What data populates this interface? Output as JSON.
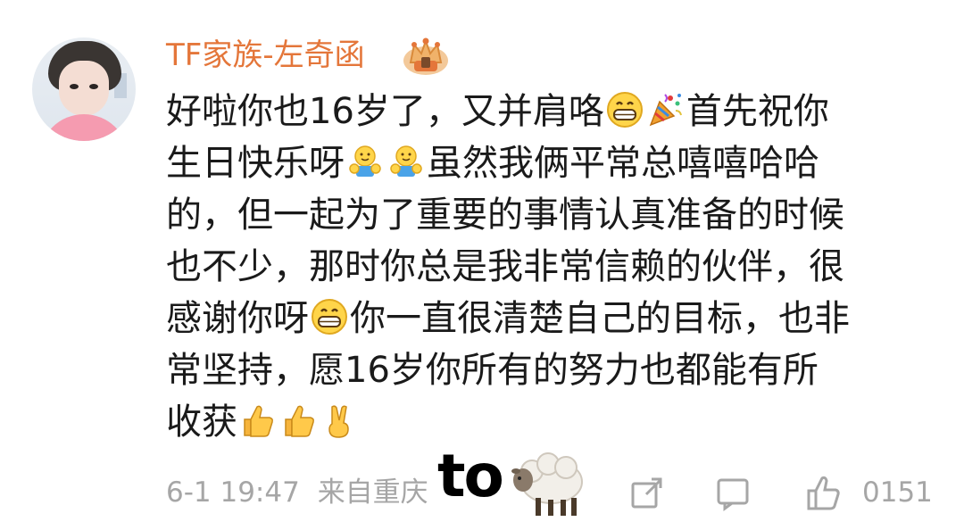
{
  "comment": {
    "avatar_label": "user-avatar",
    "username": "TF家族-左奇函",
    "badge_icon": "crown-badge-icon",
    "lines": [
      [
        "好啦你也16岁了，又并肩咯",
        "grin-icon",
        "party-popper-icon",
        "首先祝你"
      ],
      [
        "生日快乐呀",
        "hug-icon",
        "hug-icon",
        "虽然我俩平常总嘻嘻哈哈"
      ],
      [
        "的，但一起为了重要的事情认真准备的时候"
      ],
      [
        "也不少，那时你总是我非常信赖的伙伴，很"
      ],
      [
        "感谢你呀",
        "grin-icon",
        "你一直很清楚自己的目标，也非"
      ],
      [
        "常坚持，愿16岁你所有的努力也都能有所"
      ],
      [
        "收获",
        "thumbs-up-icon",
        "thumbs-up-icon",
        "victory-hand-icon"
      ]
    ]
  },
  "footer": {
    "date": "6-1 19:47",
    "source_prefix": "来自重庆",
    "share_icon": "share-icon",
    "reply_icon": "comment-icon",
    "like_icon": "like-icon",
    "like_count": "0151"
  },
  "overlay": {
    "text": "to",
    "icon": "sheep-icon"
  },
  "colors": {
    "username": "#e4763a",
    "text": "#1a1a1a",
    "meta": "#a6a6a6"
  }
}
